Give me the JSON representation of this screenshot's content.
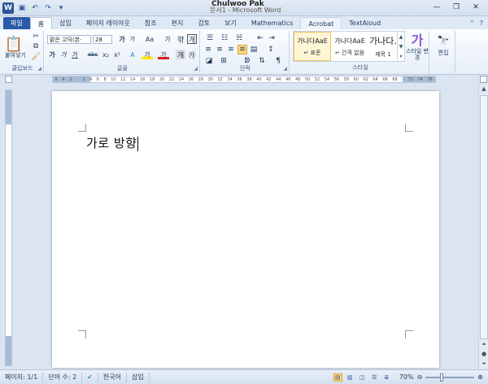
{
  "titlebar": {
    "user": "Chulwoo Pak",
    "doc_title": "문서1 - Microsoft Word",
    "qat_icons": [
      "word-logo",
      "save-icon",
      "undo-icon",
      "redo-icon",
      "customize-icon"
    ],
    "controls": [
      "minimize",
      "restore",
      "close"
    ]
  },
  "tabs": [
    {
      "label": "파일",
      "style": "file"
    },
    {
      "label": "홈",
      "style": "active"
    },
    {
      "label": "삽입"
    },
    {
      "label": "페이지 레이아웃"
    },
    {
      "label": "참조"
    },
    {
      "label": "편지"
    },
    {
      "label": "검토"
    },
    {
      "label": "보기"
    },
    {
      "label": "Mathematics"
    },
    {
      "label": "Acrobat",
      "style": "hl"
    },
    {
      "label": "TextAloud"
    }
  ],
  "ribbon": {
    "clipboard": {
      "label": "클립보드",
      "paste_label": "붙여넣기"
    },
    "font": {
      "label": "글꼴",
      "font_name": "맑은 고딕(본·",
      "font_size": "28",
      "bold": "가",
      "italic": "가",
      "underline": "가",
      "strike": "abc",
      "sub": "x₂",
      "sup": "x²",
      "grow": "가",
      "shrink": "가",
      "case": "Aa",
      "clear": "가",
      "highlight": "가",
      "color": "가"
    },
    "paragraph": {
      "label": "단락"
    },
    "styles": {
      "label": "스타일",
      "items": [
        {
          "preview": "가나다AaE",
          "name": "↵ 표준"
        },
        {
          "preview": "가나다AaE",
          "name": "↵ 간격 없음"
        },
        {
          "preview": "가나다.",
          "name": "제목 1"
        }
      ],
      "change_label": "스타일 변경"
    },
    "editing": {
      "label": "편집"
    }
  },
  "ruler_numbers": [
    "6",
    "4",
    "2",
    "",
    "2",
    "4",
    "6",
    "8",
    "10",
    "12",
    "14",
    "16",
    "18",
    "20",
    "22",
    "24",
    "26",
    "28",
    "30",
    "32",
    "34",
    "36",
    "38",
    "40",
    "42",
    "44",
    "46",
    "48",
    "50",
    "52",
    "54",
    "56",
    "58",
    "60",
    "62",
    "64",
    "66",
    "68",
    "",
    "72",
    "74",
    "76"
  ],
  "document": {
    "text": "가로 방향"
  },
  "statusbar": {
    "page": "페이지: 1/1",
    "words": "단어 수: 2",
    "language": "한국어",
    "mode": "삽입",
    "zoom": "70%",
    "zoom_level": 0.7
  }
}
